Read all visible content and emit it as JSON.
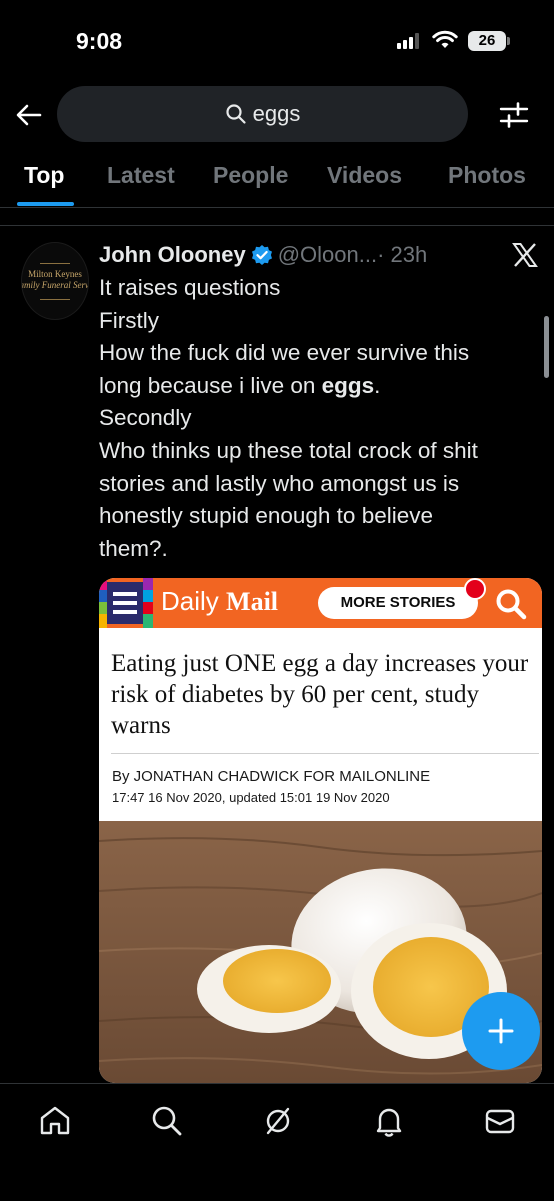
{
  "status_bar": {
    "time": "9:08",
    "battery": "26"
  },
  "search": {
    "query": "eggs"
  },
  "tabs": [
    {
      "label": "Top",
      "active": true
    },
    {
      "label": "Latest",
      "active": false
    },
    {
      "label": "People",
      "active": false
    },
    {
      "label": "Videos",
      "active": false
    },
    {
      "label": "Photos",
      "active": false
    }
  ],
  "tweet": {
    "author": "John Olooney",
    "handle": "@Oloon...",
    "time": "· 23h",
    "verified": true,
    "avatar_text": [
      "Milton Keynes",
      "Family Funeral Services"
    ],
    "body_lines": [
      "It raises questions",
      "Firstly",
      "How the fuck did we ever survive this",
      "long because i live on ",
      "Secondly",
      "Who thinks up these total crock of shit",
      "stories and lastly who amongst us is",
      "honestly stupid enough to believe",
      "them?."
    ],
    "highlight_word": "eggs",
    "highlight_suffix": "."
  },
  "media": {
    "brand_light": "Daily",
    "brand_bold": "Mail",
    "more_stories": "MORE STORIES",
    "headline": "Eating just ONE egg a day increases your risk of diabetes by 60 per cent, study warns",
    "byline": "By JONATHAN CHADWICK FOR MAILONLINE",
    "dateline": "17:47 16 Nov 2020, updated 15:01 19 Nov 2020"
  },
  "colors": {
    "accent": "#1d9bf0",
    "dailymail_orange": "#f26522",
    "background": "#000000"
  },
  "bottom_nav": [
    "home-icon",
    "search-icon",
    "grok-icon",
    "notifications-icon",
    "messages-icon"
  ]
}
